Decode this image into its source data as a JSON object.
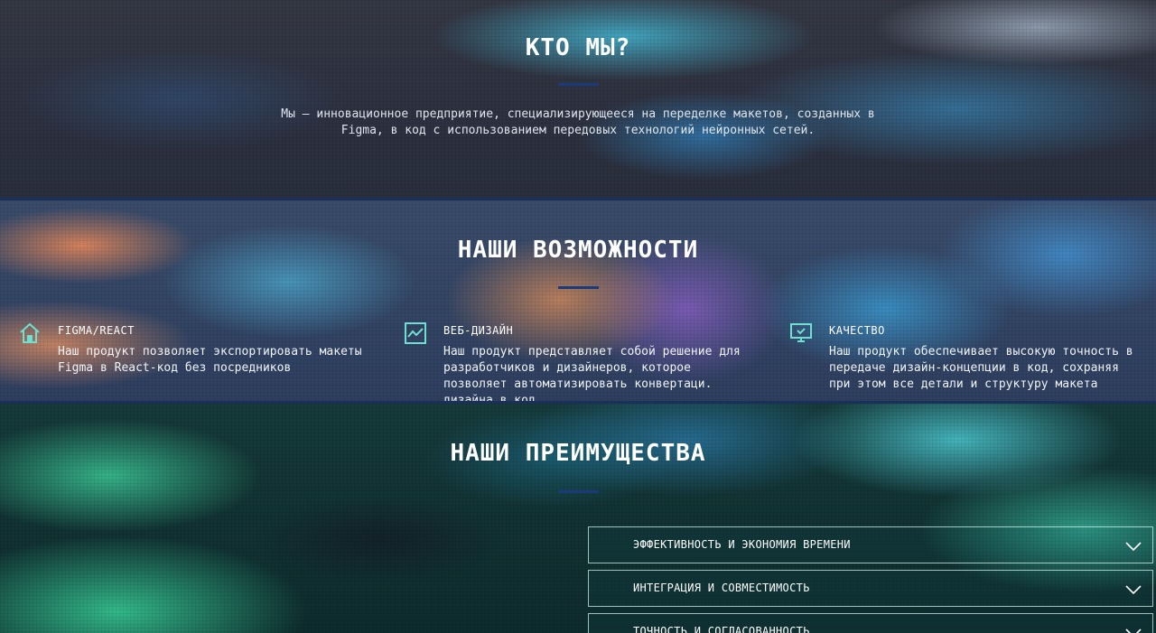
{
  "about": {
    "title": "КТО МЫ?",
    "description": "Мы – инновационное предприятие, специализирующееся на переделке макетов, созданных в Figma, в код с использованием передовых технологий нейронных сетей."
  },
  "features": {
    "title": "НАШИ ВОЗМОЖНОСТИ",
    "items": [
      {
        "icon": "house-icon",
        "name": "FIGMA/REACT",
        "text": "Наш продукт позволяет экспортировать макеты Figma в React-код без посредников"
      },
      {
        "icon": "chart-icon",
        "name": "ВЕБ-ДИЗАЙН",
        "text": "Наш продукт представляет собой решение для разработчиков и дизайнеров, которое позволяет автоматизировать конвертаци. дизайна в код"
      },
      {
        "icon": "monitor-icon",
        "name": "КАЧЕСТВО",
        "text": "Наш продукт обеспечивает высокую точность в передаче дизайн-концепции в код, сохраняя при этом все детали и структуру макета"
      }
    ]
  },
  "advantages": {
    "title": "НАШИ ПРЕИМУЩЕСТВА",
    "items": [
      {
        "label": "ЭФФЕКТИВНОСТЬ И ЭКОНОМИЯ ВРЕМЕНИ"
      },
      {
        "label": "ИНТЕГРАЦИЯ И СОВМЕСТИМОСТЬ"
      },
      {
        "label": "ТОЧНОСТЬ И СОГЛАСОВАННОСТЬ"
      }
    ]
  },
  "colors": {
    "accent": "#6fe0d0",
    "underline": "#1a3a7a",
    "divider": "#1a2f5a"
  }
}
